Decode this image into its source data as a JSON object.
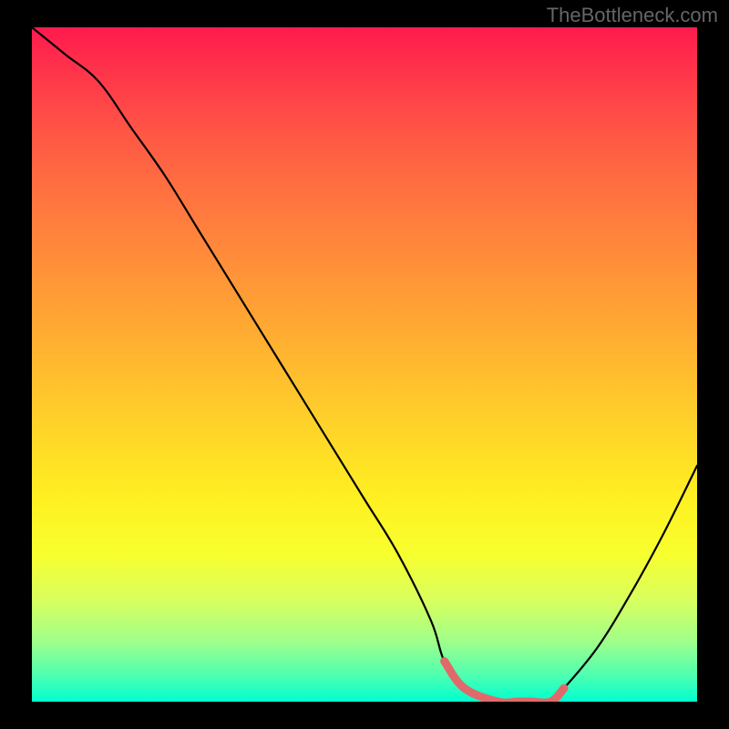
{
  "watermark": "TheBottleneck.com",
  "chart_data": {
    "type": "line",
    "title": "",
    "xlabel": "",
    "ylabel": "",
    "xlim": [
      0,
      100
    ],
    "ylim": [
      0,
      100
    ],
    "x": [
      0,
      5,
      10,
      15,
      20,
      25,
      30,
      35,
      40,
      45,
      50,
      55,
      60,
      62,
      65,
      70,
      73,
      75,
      78,
      80,
      85,
      90,
      95,
      100
    ],
    "y": [
      100,
      96,
      92,
      85,
      78,
      70,
      62,
      54,
      46,
      38,
      30,
      22,
      12,
      6,
      2,
      0,
      0,
      0,
      0,
      2,
      8,
      16,
      25,
      35
    ],
    "highlight_segment": {
      "x": [
        62,
        65,
        70,
        73,
        75,
        78,
        80
      ],
      "y": [
        6,
        2,
        0,
        0,
        0,
        0,
        2
      ],
      "color": "#e06a6a",
      "width": 9
    },
    "gradient_stops": [
      {
        "pos": 0.0,
        "color": "#ff1a4d"
      },
      {
        "pos": 0.25,
        "color": "#ff7340"
      },
      {
        "pos": 0.5,
        "color": "#ffbf2e"
      },
      {
        "pos": 0.75,
        "color": "#fff022"
      },
      {
        "pos": 1.0,
        "color": "#00ffd0"
      }
    ]
  }
}
